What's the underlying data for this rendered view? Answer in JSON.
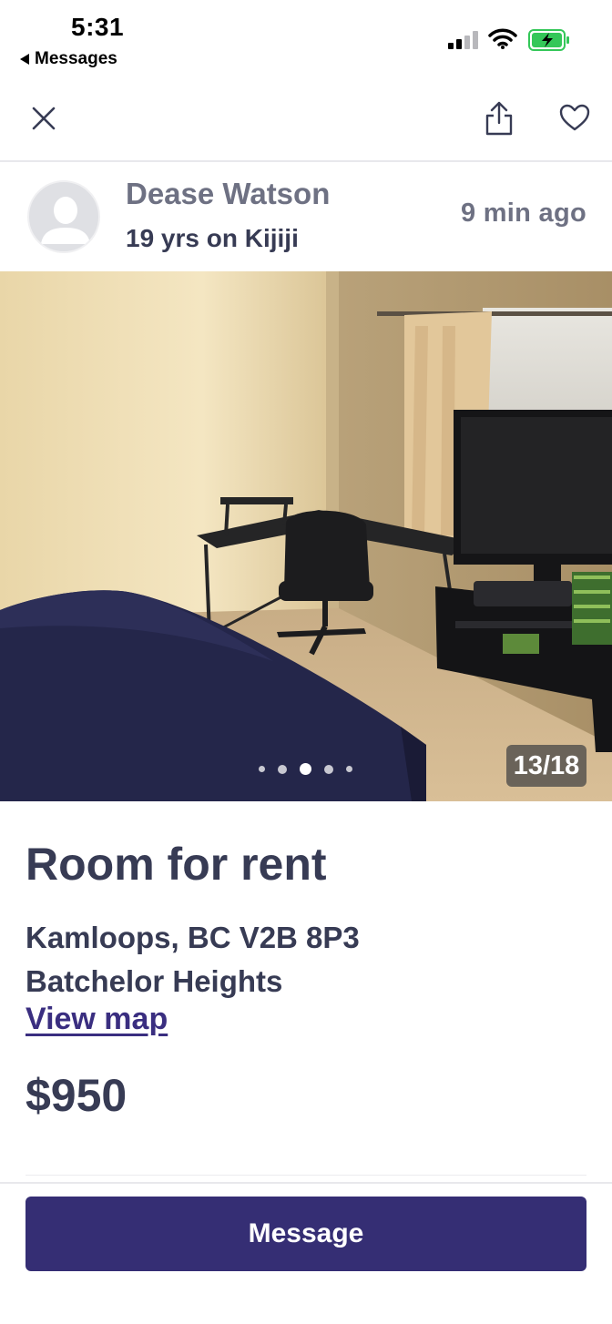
{
  "status_bar": {
    "time": "5:31",
    "back_label": "Messages",
    "icons": [
      "signal-icon",
      "wifi-icon",
      "battery-charging-icon"
    ]
  },
  "nav": {
    "icons": [
      "close-icon",
      "share-icon",
      "heart-icon"
    ]
  },
  "seller": {
    "name": "Dease Watson",
    "tenure": "19 yrs on Kijiji",
    "posted": "9 min  ago"
  },
  "gallery": {
    "counter": "13/18",
    "dot_count": 5,
    "active_dot": 3
  },
  "listing": {
    "title": "Room for rent",
    "address_line1": "Kamloops, BC V2B 8P3",
    "address_line2": "Batchelor Heights",
    "view_map_label": "View map",
    "price": "$950"
  },
  "actions": {
    "message_label": "Message"
  },
  "colors": {
    "text_dark": "#373b54",
    "text_muted": "#6e7183",
    "brand_button": "#352e74",
    "link": "#3a2e80",
    "battery_green": "#34c759"
  }
}
